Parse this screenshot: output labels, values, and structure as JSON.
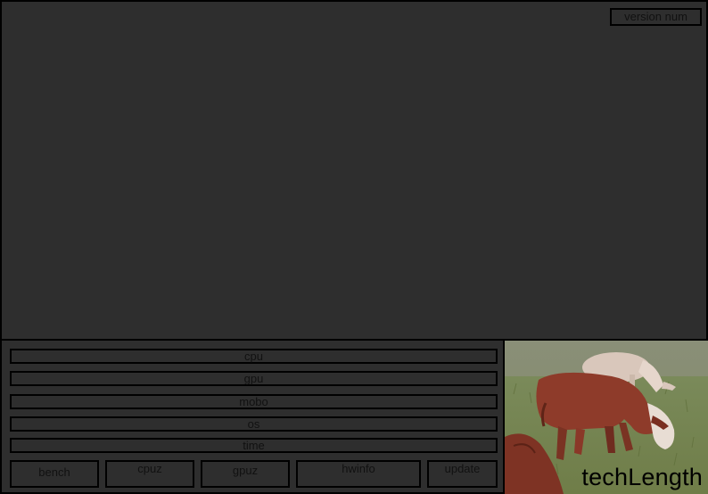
{
  "header": {
    "version_label": "version num"
  },
  "system_info": {
    "cpu_label": "cpu",
    "gpu_label": "gpu",
    "mobo_label": "mobo",
    "os_label": "os",
    "time_label": "time"
  },
  "toolbar": {
    "bench_label": "bench",
    "cpuz_label": "cpuz",
    "gpuz_label": "gpuz",
    "hwinfo_label": "hwinfo",
    "update_label": "update"
  },
  "branding": {
    "logo_text": "techLength"
  },
  "colors": {
    "background": "#2e2e2e",
    "border": "#000000",
    "text": "#111111"
  }
}
